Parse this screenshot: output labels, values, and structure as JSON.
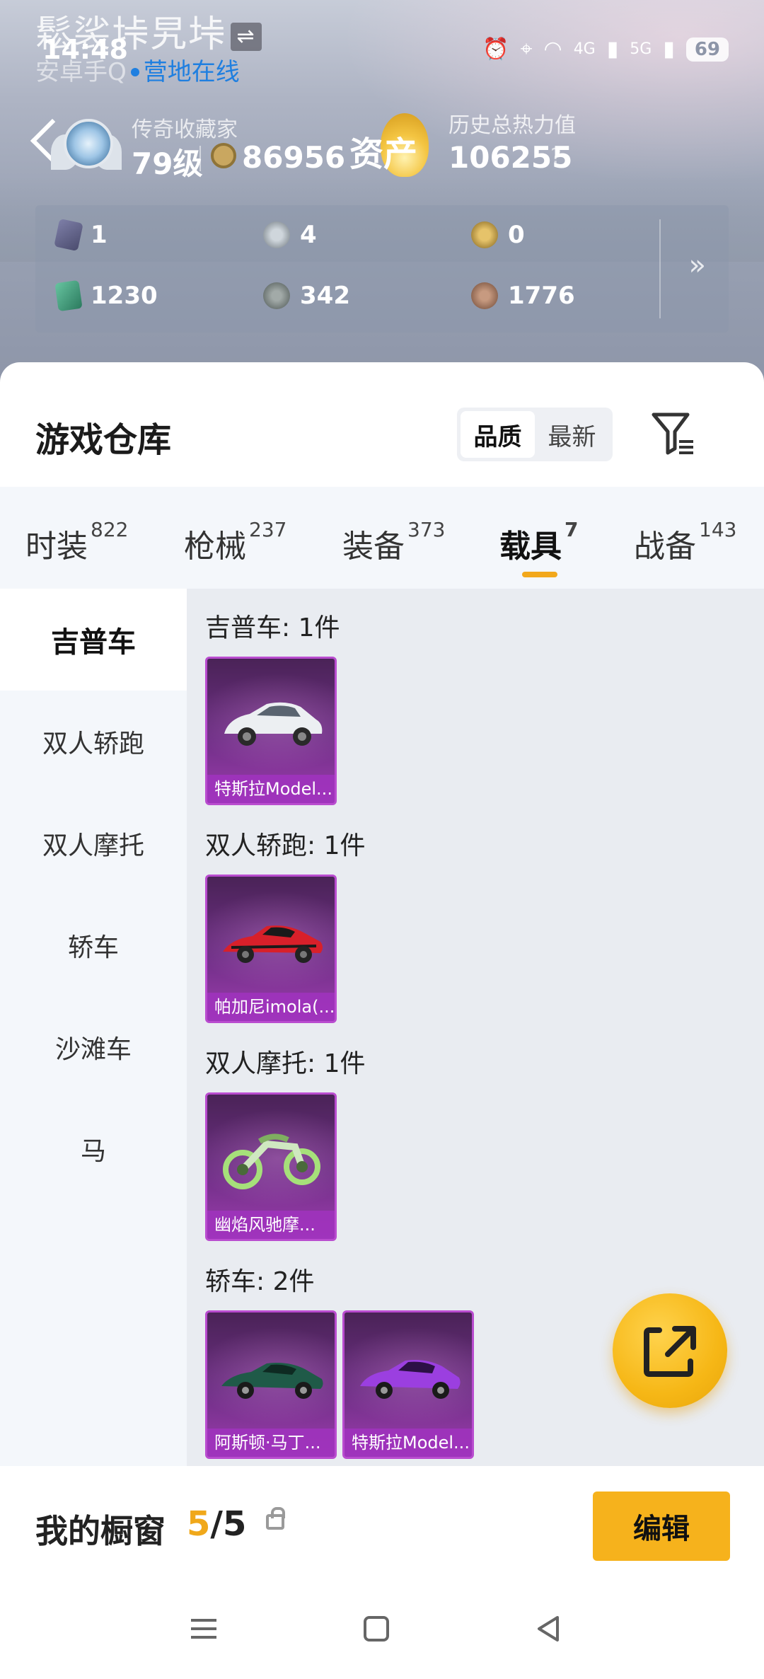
{
  "status_bar": {
    "time": "14:48",
    "battery": "69",
    "signal_4g": "4G",
    "signal_5g": "5G"
  },
  "profile": {
    "name": "鬆裟垰旯垰",
    "swap_badge": "⇌",
    "platform": "安卓手Q",
    "online_status": "营地在线",
    "rank_title": "传奇收藏家",
    "level": "79级",
    "coins": "86956",
    "asset_label": "资产",
    "heat_title": "历史总热力值",
    "heat_value": "106255",
    "help": "?"
  },
  "stats": {
    "items": [
      {
        "icon": "card-purple-icon",
        "value": "1"
      },
      {
        "icon": "silver-coin-icon",
        "value": "4"
      },
      {
        "icon": "gold-coin-icon",
        "value": "0"
      },
      {
        "icon": "card-green-icon",
        "value": "1230"
      },
      {
        "icon": "dark-coin-icon",
        "value": "342"
      },
      {
        "icon": "bronze-coin-icon",
        "value": "1776"
      }
    ],
    "more": "»"
  },
  "warehouse": {
    "title": "游戏仓库",
    "sort_options": [
      "品质",
      "最新"
    ],
    "active_sort": "品质"
  },
  "tabs": [
    {
      "label": "时装",
      "count": "822"
    },
    {
      "label": "枪械",
      "count": "237"
    },
    {
      "label": "装备",
      "count": "373"
    },
    {
      "label": "载具",
      "count": "7"
    },
    {
      "label": "战备",
      "count": "143"
    }
  ],
  "active_tab": "载具",
  "sidebar": [
    "吉普车",
    "双人轿跑",
    "双人摩托",
    "轿车",
    "沙滩车",
    "马"
  ],
  "groups": [
    {
      "title": "吉普车: 1件",
      "items": [
        "特斯拉Model..."
      ]
    },
    {
      "title": "双人轿跑: 1件",
      "items": [
        "帕加尼imola(..."
      ]
    },
    {
      "title": "双人摩托: 1件",
      "items": [
        "幽焰风驰摩..."
      ]
    },
    {
      "title": "轿车: 2件",
      "items": [
        "阿斯顿·马丁...",
        "特斯拉Model..."
      ]
    }
  ],
  "showcase": {
    "label": "我的橱窗",
    "current": "5",
    "total": "/5",
    "edit": "编辑"
  },
  "colors": {
    "accent": "#f6b21c",
    "card_purple": "#6f2f86",
    "online_blue": "#1f7fe0"
  }
}
